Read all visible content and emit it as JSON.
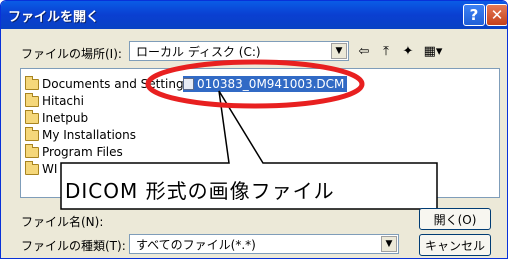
{
  "window": {
    "title": "ファイルを開く",
    "help_glyph": "?",
    "close_glyph": "✕"
  },
  "location": {
    "label": "ファイルの場所(I):",
    "value": "ローカル ディスク (C:)",
    "arrow": "▼"
  },
  "toolbar": {
    "back": "⇦",
    "up": "⤒",
    "new_folder": "✦",
    "view": "▦▾"
  },
  "file_list": {
    "folders": [
      "Documents and Settings",
      "Hitachi",
      "Inetpub",
      "My Installations",
      "Program Files",
      "WI"
    ],
    "selected_file": "010383_0M941003.DCM"
  },
  "callout": {
    "text": "DICOM 形式の画像ファイル",
    "highlight_color": "#e82020"
  },
  "filename": {
    "label": "ファイル名(N):"
  },
  "filetype": {
    "label": "ファイルの種類(T):",
    "value": "すべてのファイル(*.*)",
    "arrow": "▼"
  },
  "buttons": {
    "open": "開く(O)",
    "cancel": "キャンセル"
  }
}
